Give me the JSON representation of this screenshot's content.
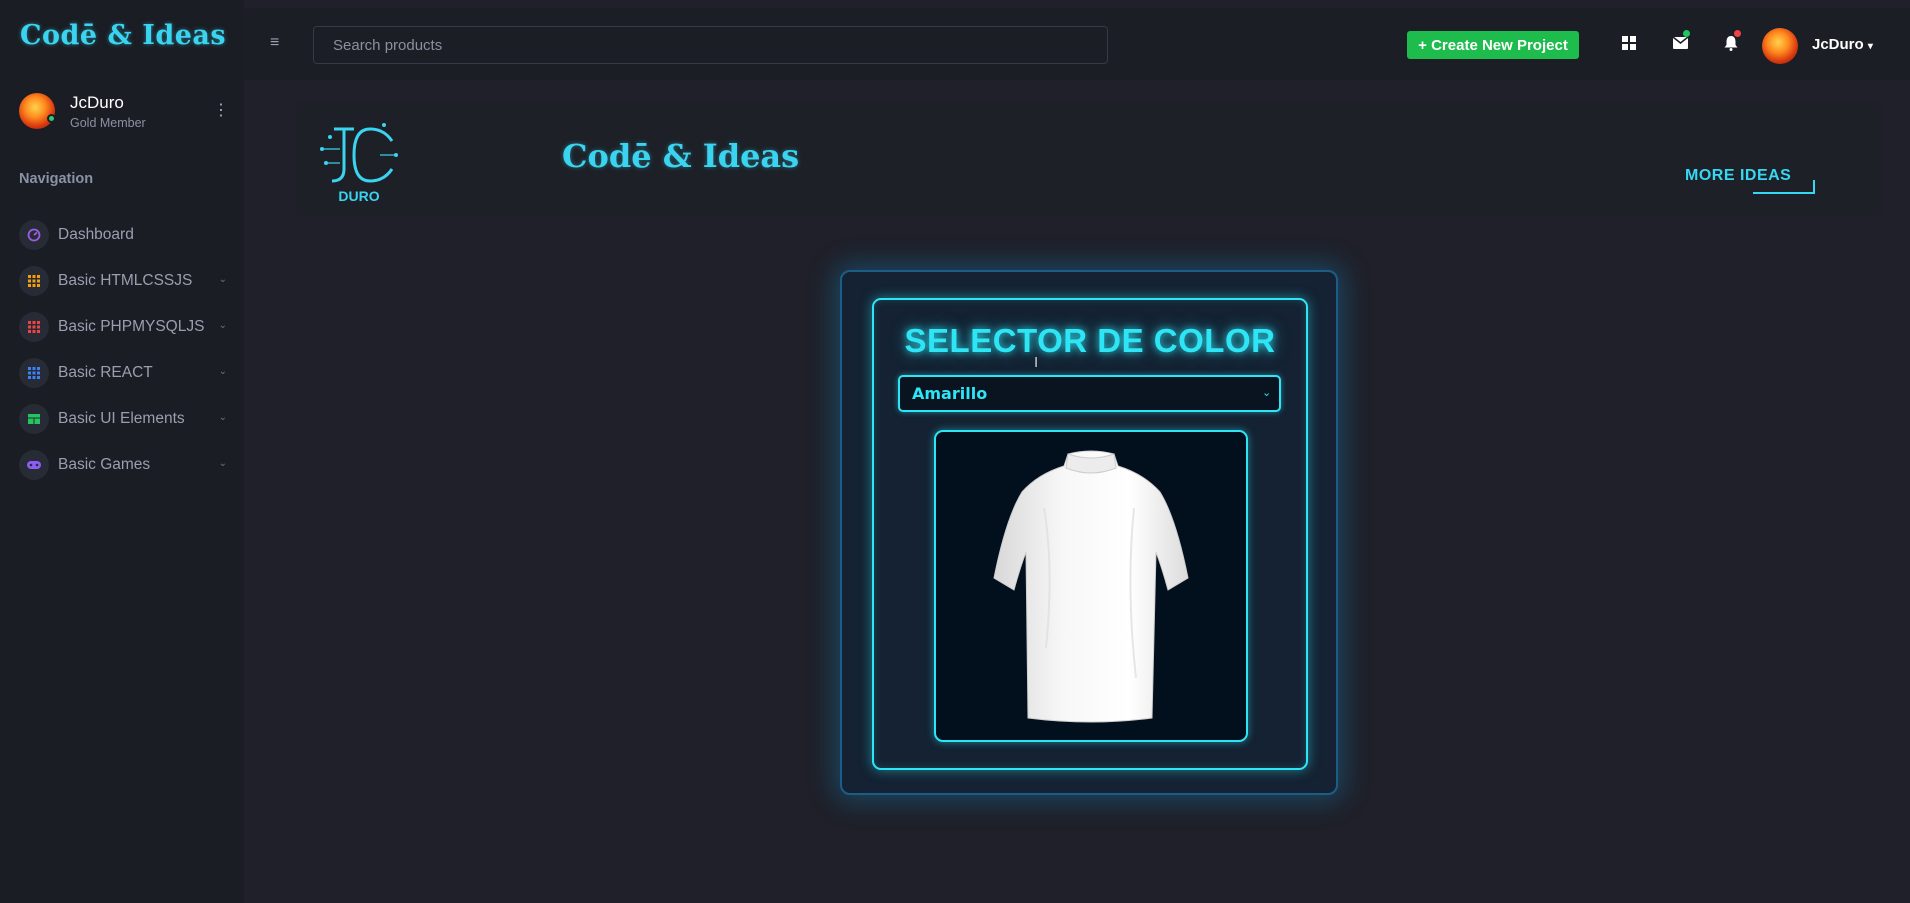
{
  "sidebar": {
    "brand": "Codē & Ideas",
    "profile": {
      "name": "JcDuro",
      "role": "Gold Member"
    },
    "nav_heading": "Navigation",
    "items": [
      {
        "label": "Dashboard",
        "icon": "gauge-icon",
        "color": "#9b5de5",
        "has_chevron": false
      },
      {
        "label": "Basic HTMLCSSJS",
        "icon": "grid-icon",
        "color": "#f59e0b",
        "has_chevron": true
      },
      {
        "label": "Basic PHPMYSQLJS",
        "icon": "grid-icon",
        "color": "#ef4444",
        "has_chevron": true
      },
      {
        "label": "Basic REACT",
        "icon": "grid-icon",
        "color": "#3b82f6",
        "has_chevron": true
      },
      {
        "label": "Basic UI Elements",
        "icon": "table-icon",
        "color": "#22c55e",
        "has_chevron": true
      },
      {
        "label": "Basic Games",
        "icon": "gamepad-icon",
        "color": "#8b5cf6",
        "has_chevron": true
      }
    ]
  },
  "topbar": {
    "search_placeholder": "Search products",
    "create_label": "+ Create New Project",
    "user_name": "JcDuro",
    "icons": [
      "apps-icon",
      "mail-icon",
      "bell-icon"
    ]
  },
  "hero": {
    "logo_text": "DURO",
    "title": "Codē & Ideas",
    "more_label": "MORE IDEAS"
  },
  "color_selector": {
    "title": "SELECTOR DE COLOR",
    "selected": "Amarillo",
    "preview_color": "#ffffff"
  },
  "colors": {
    "accent": "#2ee5f5",
    "brand": "#3ad4f0",
    "create_button": "#1ebc4d"
  }
}
